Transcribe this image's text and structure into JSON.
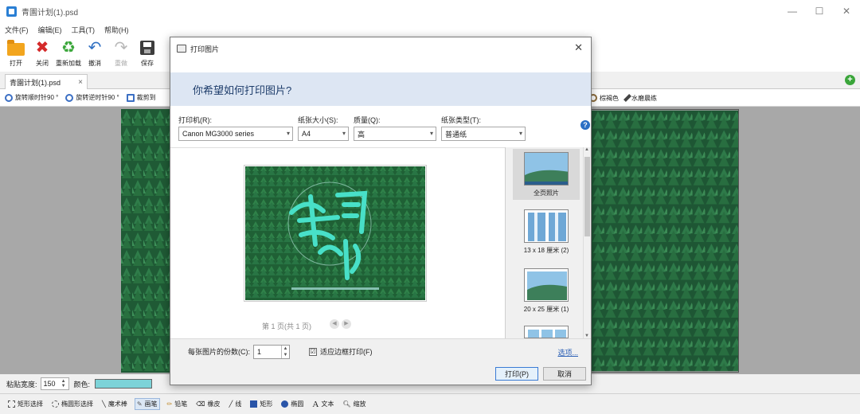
{
  "app": {
    "title": "青園计划(1).psd",
    "window_controls": [
      "—",
      "☐",
      "✕"
    ]
  },
  "menu": [
    "文件(F)",
    "编辑(E)",
    "工具(T)",
    "帮助(H)"
  ],
  "toolbar": [
    {
      "label": "打开",
      "icon": "open-folder-icon"
    },
    {
      "label": "关闭",
      "icon": "close-x-icon"
    },
    {
      "label": "重新加载",
      "icon": "reload-icon"
    },
    {
      "label": "撤消",
      "icon": "undo-icon"
    },
    {
      "label": "重做",
      "icon": "redo-icon"
    },
    {
      "label": "保存",
      "icon": "save-icon"
    }
  ],
  "doc_tab": {
    "label": "青園计划(1).psd",
    "close": "×"
  },
  "subtoolbar": {
    "left": [
      "旋转顺时针90 °",
      "旋转逆时针90 °",
      "裁剪到"
    ],
    "right": [
      "棕褐色",
      "水磨晨练"
    ]
  },
  "status": {
    "brush_width_label": "粘贴宽度:",
    "brush_width": "150",
    "color_label": "颜色:"
  },
  "bottom_tools": [
    {
      "label": "矩形选择",
      "active": false
    },
    {
      "label": "椭圆形选择",
      "active": false
    },
    {
      "label": "魔术棒",
      "active": false
    },
    {
      "label": "画笔",
      "active": true
    },
    {
      "label": "铅笔",
      "active": false
    },
    {
      "label": "橡皮",
      "active": false
    },
    {
      "label": "线",
      "active": false
    },
    {
      "label": "矩形",
      "active": false
    },
    {
      "label": "椭圆",
      "active": false
    },
    {
      "label": "文本",
      "active": false
    },
    {
      "label": "缩放",
      "active": false
    }
  ],
  "dialog": {
    "title": "打印图片",
    "close": "✕",
    "header": "你希望如何打印图片?",
    "printer_label": "打印机(R):",
    "printer_value": "Canon MG3000 series",
    "paper_size_label": "纸张大小(S):",
    "paper_size_value": "A4",
    "quality_label": "质量(Q):",
    "quality_value": "高",
    "paper_type_label": "纸张类型(T):",
    "paper_type_value": "普通纸",
    "help": "?",
    "page_nav": "第 1 页(共 1 页)",
    "layouts": [
      {
        "label": "全页照片",
        "selected": true
      },
      {
        "label": "13 x 18 厘米 (2)",
        "selected": false
      },
      {
        "label": "20 x 25 厘米 (1)",
        "selected": false
      }
    ],
    "copies_label": "每张图片的份数(C):",
    "copies_value": "1",
    "fit_label": "适应边框打印(F)",
    "fit_checked": "☑",
    "options_link": "选项...",
    "print_button": "打印(P)",
    "cancel_button": "取消"
  }
}
